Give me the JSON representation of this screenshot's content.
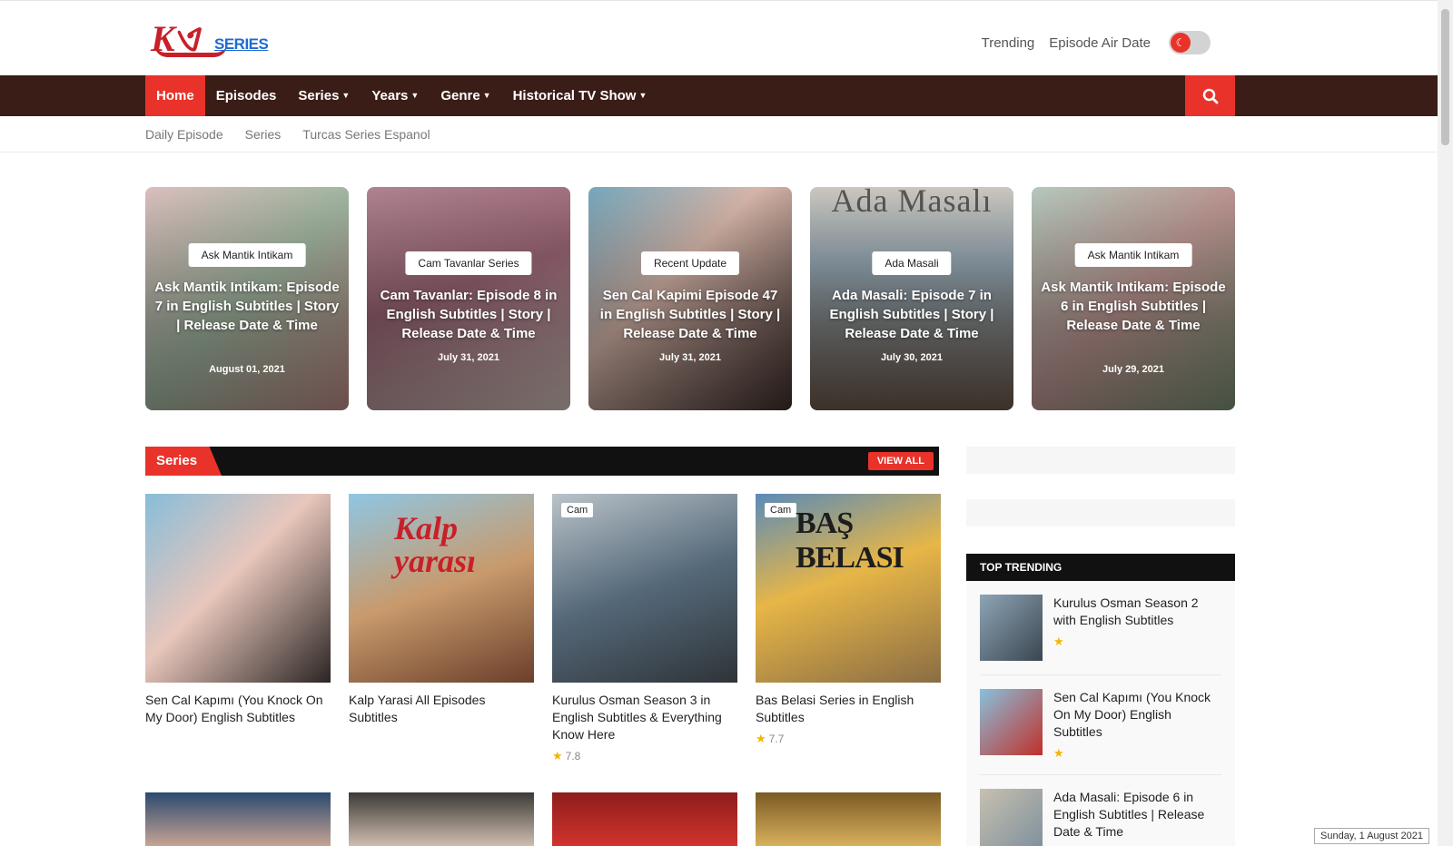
{
  "header": {
    "logo_text": "SERIES",
    "links": [
      "Trending",
      "Episode Air Date"
    ],
    "theme_toggle": "moon-icon"
  },
  "nav": {
    "items": [
      {
        "label": "Home",
        "active": true,
        "dropdown": false
      },
      {
        "label": "Episodes",
        "active": false,
        "dropdown": false
      },
      {
        "label": "Series",
        "active": false,
        "dropdown": true
      },
      {
        "label": "Years",
        "active": false,
        "dropdown": true
      },
      {
        "label": "Genre",
        "active": false,
        "dropdown": true
      },
      {
        "label": "Historical TV Show",
        "active": false,
        "dropdown": true
      }
    ],
    "search_icon": "search-icon",
    "accent": "#e9332a",
    "bar_color": "#3b1d17"
  },
  "subnav": [
    "Daily Episode",
    "Series",
    "Turcas Series Espanol"
  ],
  "featured": [
    {
      "category": "Ask Mantik Intikam",
      "title": "Ask Mantik Intikam: Episode 7 in English Subtitles | Story | Release Date & Time",
      "date": "August 01, 2021"
    },
    {
      "category": "Cam Tavanlar Series",
      "title": "Cam Tavanlar: Episode 8 in English Subtitles | Story | Release Date & Time",
      "date": "July 31, 2021"
    },
    {
      "category": "Recent Update",
      "title": "Sen Cal Kapimi Episode 47 in English Subtitles | Story | Release Date & Time",
      "date": "July 31, 2021"
    },
    {
      "category": "Ada Masali",
      "title": "Ada Masali: Episode 7 in English Subtitles | Story | Release Date & Time",
      "date": "July 30, 2021",
      "poster_text": "Ada Masalı"
    },
    {
      "category": "Ask Mantik Intikam",
      "title": "Ask Mantik Intikam: Episode 6 in English Subtitles | Release Date & Time",
      "date": "July 29, 2021"
    }
  ],
  "series_section": {
    "heading": "Series",
    "view_all": "VIEW ALL",
    "cards": [
      {
        "title": "Sen Cal Kapımı (You Knock On My Door) English Subtitles",
        "badge": "",
        "rating": ""
      },
      {
        "title": "Kalp Yarasi All Episodes Subtitles",
        "badge": "",
        "rating": "",
        "poster_text": "Kalp yarası"
      },
      {
        "title": "Kurulus Osman Season 3 in English Subtitles & Everything Know Here",
        "badge": "Cam",
        "rating": "7.8"
      },
      {
        "title": "Bas Belasi Series in English Subtitles",
        "badge": "Cam",
        "rating": "7.7",
        "poster_text": "BAŞ BELASI"
      }
    ]
  },
  "sidebar": {
    "trending_heading": "TOP TRENDING",
    "items": [
      {
        "title": "Kurulus Osman Season 2 with English Subtitles"
      },
      {
        "title": "Sen Cal Kapımı (You Knock On My Door) English Subtitles"
      },
      {
        "title": "Ada Masali: Episode 6 in English Subtitles | Release Date & Time"
      }
    ]
  },
  "taskbar_date": "Sunday, 1 August 2021"
}
